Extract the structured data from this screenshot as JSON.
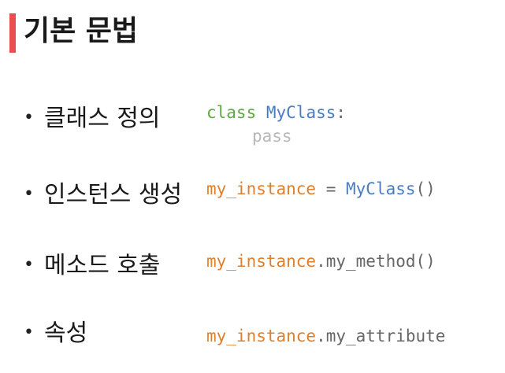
{
  "title": "기본 문법",
  "bullet_symbol": "•",
  "items": [
    {
      "label": "클래스 정의",
      "code_line1": {
        "keyword": "class",
        "space": " ",
        "name": "MyClass",
        "colon": ":"
      },
      "code_line2": "pass"
    },
    {
      "label": "인스턴스 생성",
      "code": {
        "var": "my_instance",
        "op": " = ",
        "cls": "MyClass",
        "call": "()"
      }
    },
    {
      "label": "메소드 호출",
      "code": {
        "var": "my_instance",
        "rest": ".my_method()"
      }
    },
    {
      "label": "속성",
      "code": {
        "var": "my_instance",
        "rest": ".my_attribute"
      }
    }
  ],
  "colors": {
    "accent_bar": "#ea4f4f",
    "keyword": "#5fa845",
    "class_name": "#4a7cc4",
    "variable": "#e0802e",
    "plain_code": "#666666",
    "faint_code": "#b8b8b8"
  }
}
